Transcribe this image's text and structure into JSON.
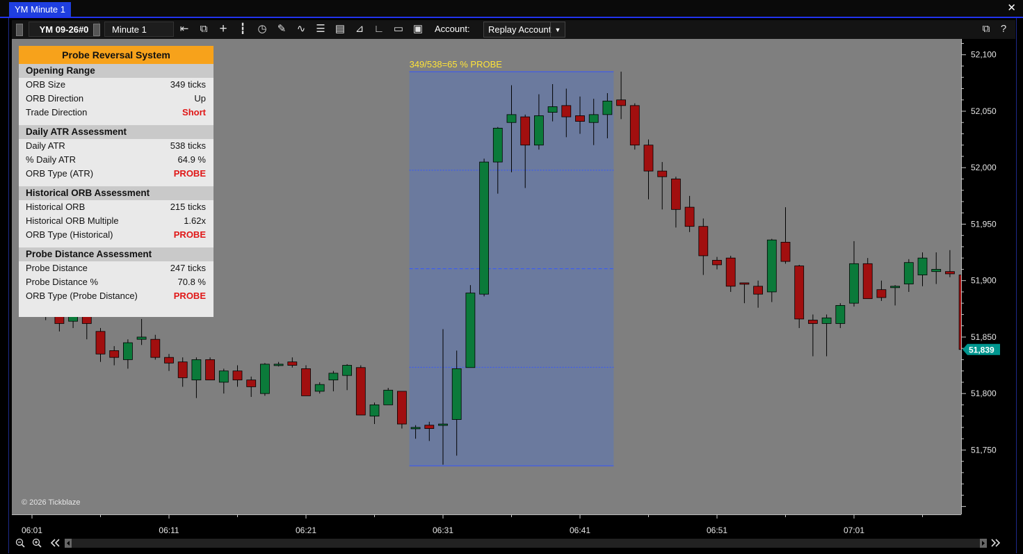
{
  "window": {
    "title": "YM Minute 1",
    "close_glyph": "✕"
  },
  "toolbar": {
    "instrument": "YM 09-26#0",
    "timeframe": "Minute 1",
    "account_label": "Account:",
    "account_value": "Replay Account",
    "help_glyph": "?",
    "icons": [
      "bar-spacing-icon",
      "autoscale-icon",
      "crosshair-icon",
      "chart-style-icon",
      "clock-icon",
      "pencil-icon",
      "drawing-tools-icon",
      "indicators-icon",
      "strategy-report-icon",
      "line-tool-icon",
      "angle-tool-icon",
      "folder-icon",
      "save-icon"
    ]
  },
  "panel": {
    "title": "Probe Reversal System",
    "sections": [
      {
        "heading": "Opening Range",
        "rows": [
          {
            "label": "ORB Size",
            "value": "349 ticks"
          },
          {
            "label": "ORB Direction",
            "value": "Up"
          },
          {
            "label": "Trade Direction",
            "value": "Short",
            "highlight": true
          }
        ]
      },
      {
        "heading": "Daily ATR Assessment",
        "rows": [
          {
            "label": "Daily ATR",
            "value": "538 ticks"
          },
          {
            "label": "% Daily ATR",
            "value": "64.9 %"
          },
          {
            "label": "ORB Type (ATR)",
            "value": "PROBE",
            "highlight": true
          }
        ]
      },
      {
        "heading": "Historical ORB Assessment",
        "rows": [
          {
            "label": "Historical ORB",
            "value": "215 ticks"
          },
          {
            "label": "Historical ORB Multiple",
            "value": "1.62x"
          },
          {
            "label": "ORB Type (Historical)",
            "value": "PROBE",
            "highlight": true
          }
        ]
      },
      {
        "heading": "Probe Distance Assessment",
        "rows": [
          {
            "label": "Probe Distance",
            "value": "247 ticks"
          },
          {
            "label": "Probe Distance %",
            "value": "70.8 %"
          },
          {
            "label": "ORB Type (Probe Distance)",
            "value": "PROBE",
            "highlight": true
          }
        ]
      }
    ]
  },
  "chart": {
    "range_label": "349/538=65 % PROBE",
    "copyright": "© 2026 Tickblaze",
    "current_price_label": "51,839",
    "y_ticks": [
      "52,100",
      "52,050",
      "52,000",
      "51,950",
      "51,900",
      "51,850",
      "51,800",
      "51,750"
    ],
    "x_ticks": [
      "06:01",
      "06:11",
      "06:21",
      "06:31",
      "06:41",
      "06:51",
      "07:01"
    ],
    "colors": {
      "up": "#0b7a3a",
      "down": "#a10f0f",
      "range_fill": "#6b7a9e",
      "current_price": "#00968f",
      "panel_header": "#f7a21b"
    }
  },
  "chart_data": {
    "type": "candlestick",
    "x_start": "06:01",
    "interval": "1 minute",
    "y_unit": "price",
    "ylim": [
      51693,
      52114
    ],
    "opening_range": {
      "start": "06:29",
      "end": "06:43",
      "high": 52085,
      "low": 51736
    },
    "current_price": 51839,
    "ohlc": [
      [
        51905,
        51915,
        51870,
        51890
      ],
      [
        51888,
        51900,
        51865,
        51880
      ],
      [
        51880,
        51890,
        51855,
        51862
      ],
      [
        51864,
        51880,
        51858,
        51872
      ],
      [
        51875,
        51885,
        51848,
        51862
      ],
      [
        51855,
        51858,
        51828,
        51835
      ],
      [
        51838,
        51842,
        51825,
        51832
      ],
      [
        51830,
        51848,
        51822,
        51845
      ],
      [
        51848,
        51866,
        51843,
        51850
      ],
      [
        51848,
        51852,
        51830,
        51832
      ],
      [
        51832,
        51835,
        51820,
        51827
      ],
      [
        51828,
        51832,
        51806,
        51814
      ],
      [
        51812,
        51832,
        51796,
        51830
      ],
      [
        51830,
        51832,
        51812,
        51812
      ],
      [
        51810,
        51822,
        51800,
        51820
      ],
      [
        51820,
        51825,
        51806,
        51812
      ],
      [
        51812,
        51815,
        51797,
        51806
      ],
      [
        51800,
        51827,
        51798,
        51826
      ],
      [
        51826,
        51828,
        51824,
        51826
      ],
      [
        51828,
        51832,
        51823,
        51825
      ],
      [
        51822,
        51825,
        51798,
        51798
      ],
      [
        51802,
        51810,
        51800,
        51808
      ],
      [
        51812,
        51820,
        51802,
        51818
      ],
      [
        51816,
        51826,
        51803,
        51825
      ],
      [
        51823,
        51825,
        51782,
        51781
      ],
      [
        51780,
        51792,
        51773,
        51790
      ],
      [
        51790,
        51805,
        51795,
        51803
      ],
      [
        51802,
        51802,
        51769,
        51773
      ],
      [
        51770,
        51772,
        51760,
        51770
      ],
      [
        51772,
        51775,
        51758,
        51769
      ],
      [
        51772,
        51857,
        51737,
        51773
      ],
      [
        51777,
        51838,
        51745,
        51822
      ],
      [
        51823,
        51896,
        51823,
        51889
      ],
      [
        51888,
        52008,
        51886,
        52005
      ],
      [
        52005,
        52036,
        51977,
        52035
      ],
      [
        52040,
        52073,
        51996,
        52047
      ],
      [
        52045,
        52047,
        51982,
        52020
      ],
      [
        52020,
        52065,
        52016,
        52046
      ],
      [
        52049,
        52074,
        52041,
        52054
      ],
      [
        52055,
        52070,
        52027,
        52045
      ],
      [
        52046,
        52063,
        52030,
        52041
      ],
      [
        52040,
        52061,
        52020,
        52047
      ],
      [
        52047,
        52066,
        52026,
        52059
      ],
      [
        52060,
        52085,
        52043,
        52055
      ],
      [
        52055,
        52057,
        52016,
        52020
      ],
      [
        52020,
        52025,
        51972,
        51997
      ],
      [
        51997,
        52005,
        51963,
        51992
      ],
      [
        51990,
        51992,
        51947,
        51963
      ],
      [
        51965,
        51975,
        51943,
        51948
      ],
      [
        51948,
        51955,
        51905,
        51922
      ],
      [
        51918,
        51921,
        51910,
        51914
      ],
      [
        51920,
        51922,
        51890,
        51895
      ],
      [
        51898,
        51898,
        51880,
        51897
      ],
      [
        51895,
        51900,
        51876,
        51888
      ],
      [
        51890,
        51937,
        51881,
        51936
      ],
      [
        51934,
        51965,
        51915,
        51917
      ],
      [
        51913,
        51914,
        51858,
        51866
      ],
      [
        51865,
        51870,
        51833,
        51862
      ],
      [
        51862,
        51870,
        51833,
        51867
      ],
      [
        51862,
        51880,
        51858,
        51878
      ],
      [
        51880,
        51935,
        51877,
        51915
      ],
      [
        51915,
        51920,
        51884,
        51884
      ],
      [
        51892,
        51900,
        51882,
        51885
      ],
      [
        51895,
        51896,
        51878,
        51895
      ],
      [
        51897,
        51919,
        51890,
        51916
      ],
      [
        51905,
        51925,
        51895,
        51920
      ],
      [
        51908,
        51925,
        51897,
        51910
      ],
      [
        51908,
        51927,
        51903,
        51906
      ],
      [
        51905,
        51911,
        51863,
        51839
      ]
    ]
  }
}
